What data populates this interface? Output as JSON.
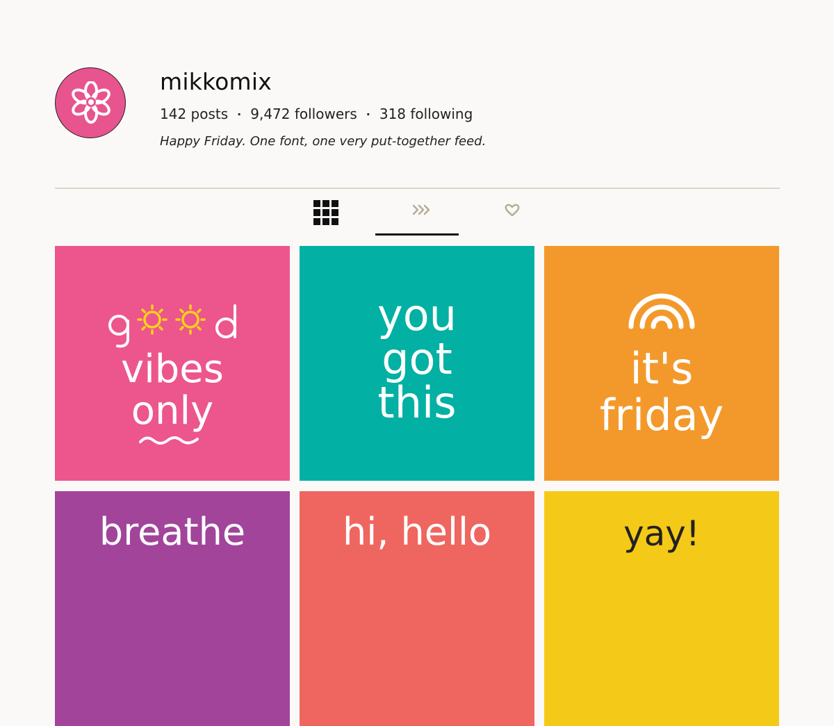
{
  "profile": {
    "username": "mikkomix",
    "posts": "142 posts",
    "followers": "9,472 followers",
    "following": "318 following",
    "separator": "·",
    "bio": "Happy Friday. One font, one very put-together feed.",
    "avatar_icon": "flower-icon",
    "avatar_color": "#e8548e"
  },
  "tabs": [
    {
      "icon": "grid-icon",
      "active": false
    },
    {
      "icon": "chevrons-icon",
      "active": true
    },
    {
      "icon": "heart-icon",
      "active": false
    }
  ],
  "posts": [
    {
      "line1": "good",
      "line2": "vibes",
      "line3": "only",
      "color": "#ec568c"
    },
    {
      "text": "you\ngot\nthis",
      "color": "#02b0a4"
    },
    {
      "text": "it's\nfriday",
      "color": "#f3992b",
      "icon": "rainbow-icon"
    },
    {
      "text": "breathe",
      "color": "#a1449a"
    },
    {
      "text": "hi, hello",
      "color": "#ef6660"
    },
    {
      "text": "yay!",
      "color": "#f5c917",
      "text_color": "#222222"
    }
  ]
}
